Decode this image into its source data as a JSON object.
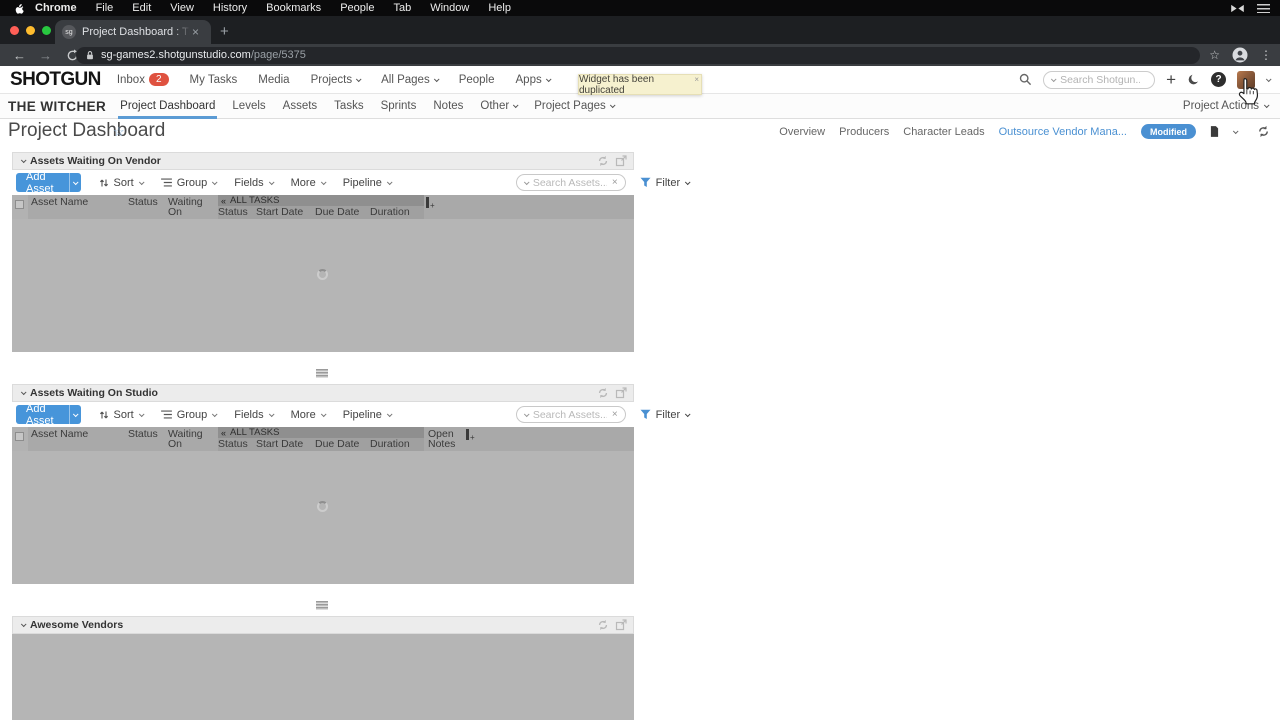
{
  "menubar": {
    "items": [
      "Chrome",
      "File",
      "Edit",
      "View",
      "History",
      "Bookmarks",
      "People",
      "Tab",
      "Window",
      "Help"
    ]
  },
  "browser": {
    "tab": {
      "title": "Project Dashboard : The Witch",
      "favicon": "sg"
    },
    "url": {
      "host": "sg-games2.shotgunstudio.com",
      "path": "/page/5375"
    }
  },
  "header": {
    "logo": "SHOTGUN",
    "nav": [
      {
        "label": "Inbox",
        "badge": "2"
      },
      {
        "label": "My Tasks"
      },
      {
        "label": "Media"
      },
      {
        "label": "Projects"
      },
      {
        "label": "All Pages"
      },
      {
        "label": "People"
      },
      {
        "label": "Apps"
      }
    ],
    "search_placeholder": "Search Shotgun..."
  },
  "project_nav": {
    "project": "THE WITCHER",
    "tabs": [
      {
        "label": "Project Dashboard"
      },
      {
        "label": "Levels"
      },
      {
        "label": "Assets"
      },
      {
        "label": "Tasks"
      },
      {
        "label": "Sprints"
      },
      {
        "label": "Notes"
      },
      {
        "label": "Other"
      },
      {
        "label": "Project Pages"
      }
    ],
    "actions": "Project Actions"
  },
  "toast": {
    "message": "Widget has been duplicated"
  },
  "page": {
    "title": "Project Dashboard",
    "links": [
      "Overview",
      "Producers",
      "Character Leads"
    ],
    "active_link": "Outsource Vendor Mana...",
    "badge": "Modified"
  },
  "toolbar": {
    "add_asset": "Add Asset",
    "sort": "Sort",
    "group": "Group",
    "fields": "Fields",
    "more": "More",
    "pipeline": "Pipeline",
    "search_placeholder": "Search Assets...",
    "filter": "Filter"
  },
  "grid": {
    "columns": [
      "Asset Name",
      "Status",
      "Waiting On"
    ],
    "group_collapse": "«",
    "group_header": "ALL TASKS",
    "task_columns": [
      "Status",
      "Start Date",
      "Due Date",
      "Duration"
    ],
    "open_notes": "Open Notes"
  },
  "widgets": [
    {
      "title": "Assets Waiting On Vendor"
    },
    {
      "title": "Assets Waiting On Studio"
    },
    {
      "title": "Awesome Vendors"
    }
  ],
  "colors": {
    "accent": "#4a90d2",
    "badge_red": "#df5240",
    "toast_bg": "#f6f1cf"
  }
}
